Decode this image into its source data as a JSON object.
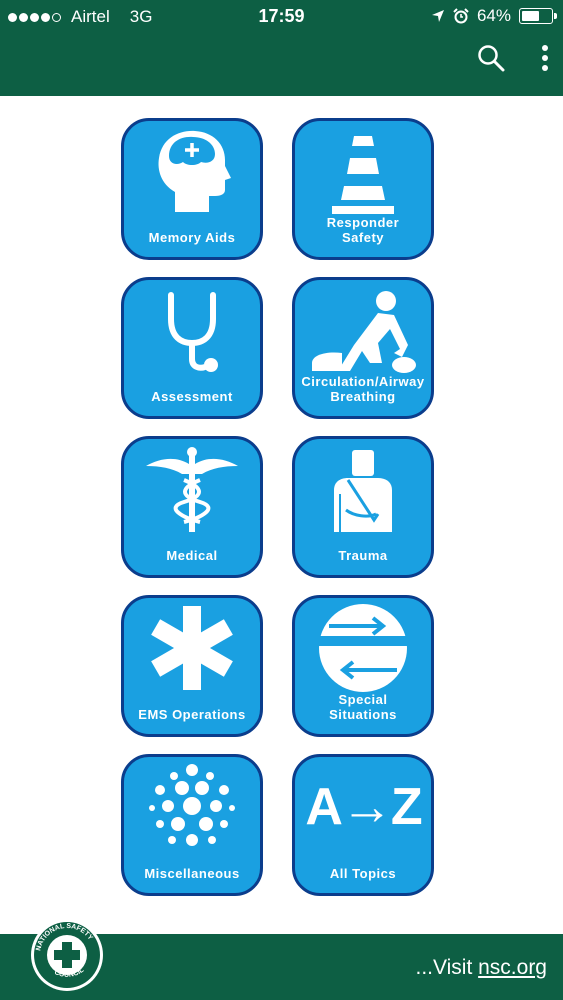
{
  "status_bar": {
    "carrier": "Airtel",
    "network": "3G",
    "time": "17:59",
    "battery_percent": "64%",
    "battery_level": 0.64
  },
  "app_bar": {
    "icons": [
      "search-icon",
      "more-vert-icon"
    ]
  },
  "tiles": [
    {
      "label": "Memory Aids",
      "icon": "head-brain-icon"
    },
    {
      "label": "Responder\nSafety",
      "icon": "traffic-cone-icon"
    },
    {
      "label": "Assessment",
      "icon": "stethoscope-icon"
    },
    {
      "label": "Circulation/Airway\nBreathing",
      "icon": "cpr-icon"
    },
    {
      "label": "Medical",
      "icon": "caduceus-icon"
    },
    {
      "label": "Trauma",
      "icon": "arm-sling-icon"
    },
    {
      "label": "EMS Operations",
      "icon": "star-of-life-icon"
    },
    {
      "label": "Special\nSituations",
      "icon": "arrows-circle-icon"
    },
    {
      "label": "Miscellaneous",
      "icon": "dots-cluster-icon"
    },
    {
      "label": "All Topics",
      "icon": "a-to-z-icon",
      "icon_text": "A→Z"
    }
  ],
  "footer": {
    "visit_prefix": "...Visit ",
    "visit_link": "nsc.org",
    "logo_text": "NATIONAL SAFETY COUNCIL"
  },
  "colors": {
    "header_bg": "#0d5f44",
    "tile_bg": "#1aa0e1",
    "tile_border": "#0b3d8c"
  }
}
